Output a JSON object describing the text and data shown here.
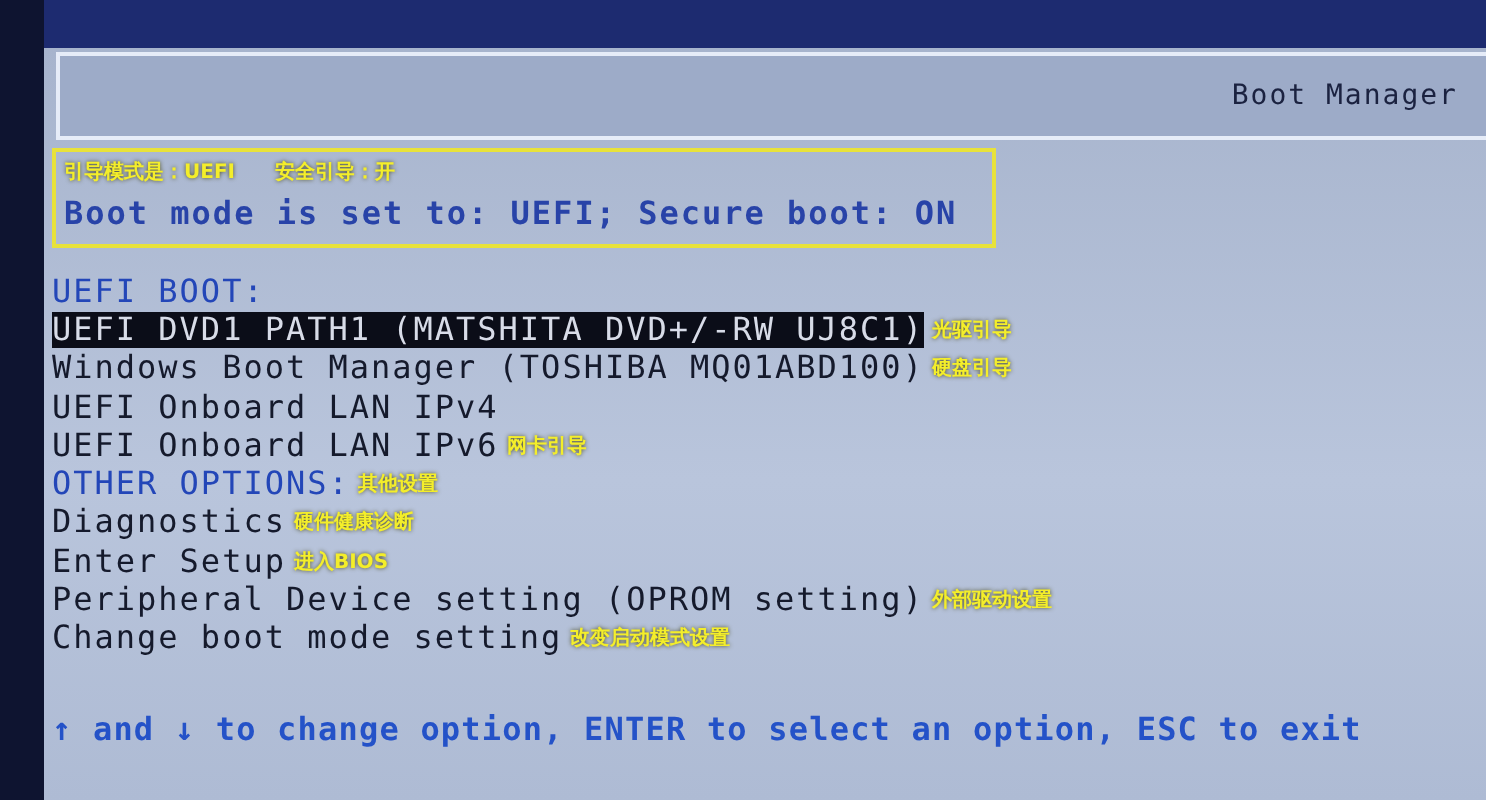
{
  "header": {
    "title": "Boot Manager"
  },
  "annotation": {
    "note": "引导模式是：UEFI　　安全引导：开",
    "status": "Boot mode is set to: UEFI; Secure boot: ON"
  },
  "menu": [
    {
      "kind": "heading",
      "text": "UEFI BOOT:"
    },
    {
      "kind": "option",
      "text": "UEFI DVD1 PATH1 (MATSHITA DVD+/-RW UJ8C1)",
      "selected": true,
      "note": "光驱引导"
    },
    {
      "kind": "option",
      "text": "Windows Boot Manager (TOSHIBA MQ01ABD100)",
      "selected": false,
      "note": "硬盘引导"
    },
    {
      "kind": "option",
      "text": "UEFI Onboard LAN IPv4",
      "selected": false
    },
    {
      "kind": "option",
      "text": "UEFI Onboard LAN IPv6",
      "selected": false,
      "note": "网卡引导"
    },
    {
      "kind": "heading",
      "text": "OTHER OPTIONS:",
      "note": "其他设置"
    },
    {
      "kind": "option",
      "text": "Diagnostics",
      "selected": false,
      "note": "硬件健康诊断"
    },
    {
      "kind": "option",
      "text": "Enter Setup",
      "selected": false,
      "note": "进入BIOS"
    },
    {
      "kind": "option",
      "text": "Peripheral Device setting (OPROM setting)",
      "selected": false,
      "note": "外部驱动设置"
    },
    {
      "kind": "option",
      "text": "Change boot mode setting",
      "selected": false,
      "note": "改变启动模式设置"
    }
  ],
  "footer": "↑ and ↓ to change option, ENTER to select an option, ESC to exit"
}
